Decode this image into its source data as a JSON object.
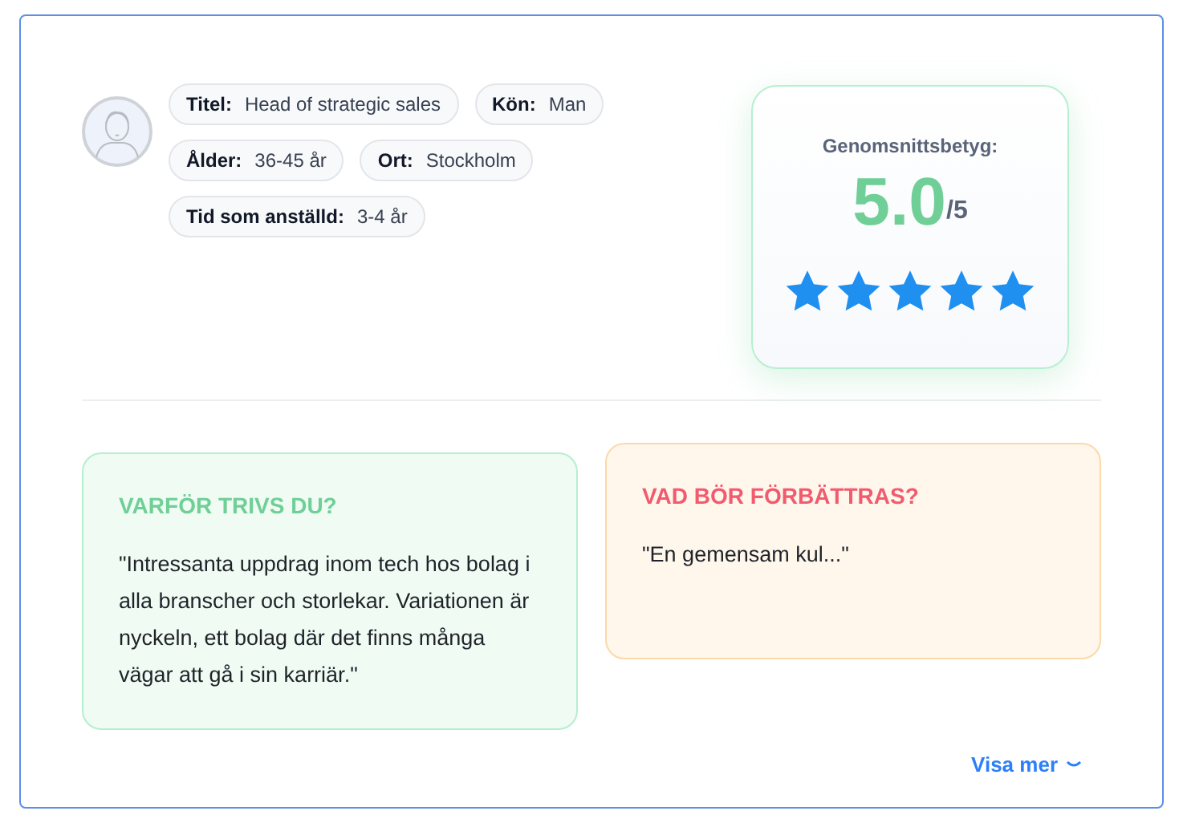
{
  "profile": {
    "facts": [
      {
        "label": "Titel:",
        "value": "Head of strategic sales"
      },
      {
        "label": "Kön:",
        "value": "Man"
      },
      {
        "label": "Ålder:",
        "value": "36-45 år"
      },
      {
        "label": "Ort:",
        "value": "Stockholm"
      },
      {
        "label": "Tid som anställd:",
        "value": "3-4 år"
      }
    ]
  },
  "rating": {
    "title": "Genomsnittsbetyg:",
    "score": "5.0",
    "max": "/5",
    "stars": 5
  },
  "panels": [
    {
      "kind": "positive",
      "title": "VARFÖR TRIVS DU?",
      "text": "\"Intressanta uppdrag inom tech hos bolag i alla branscher och storlekar. Variationen är nyckeln, ett bolag där det finns många vägar att gå i sin karriär.\""
    },
    {
      "kind": "negative",
      "title": "VAD BÖR FÖRBÄTTRAS?",
      "text": "\"En gemensam kul...\""
    }
  ],
  "show_more": "Visa mer"
}
